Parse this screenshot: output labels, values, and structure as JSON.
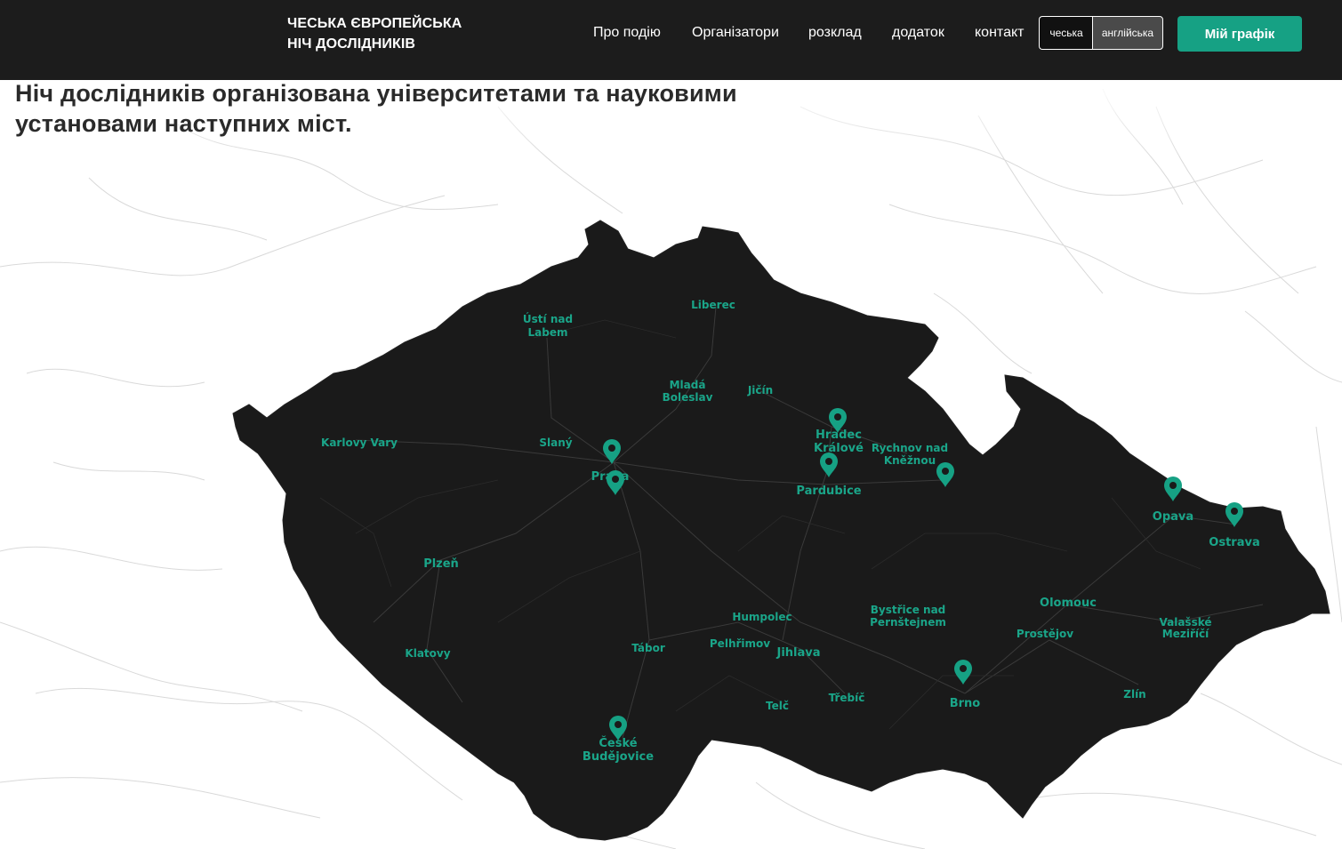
{
  "header": {
    "brand_line1": "ЧЕСЬКА ЄВРОПЕЙСЬКА",
    "brand_line2": "НІЧ ДОСЛІДНИКІВ",
    "nav": [
      "Про подію",
      "Організатори",
      "розклад",
      "додаток",
      "контакт"
    ],
    "lang_cs": "чеська",
    "lang_en": "англійська",
    "cta": "Мій графік"
  },
  "main": {
    "heading": "Ніч дослідників організована університетами та науковими установами наступних міст."
  },
  "colors": {
    "accent": "#16a184",
    "header_bg": "#1c1c1c",
    "map_fill": "#1a1a1a",
    "label_color": "#1aa589"
  },
  "map": {
    "cities": [
      "Ústí nad",
      "Labem",
      "Liberec",
      "Mladá",
      "Boleslav",
      "Jičín",
      "Karlovy Vary",
      "Slaný",
      "Praha",
      "Hradec",
      "Králové",
      "Rychnov nad",
      "Kněžnou",
      "Pardubice",
      "Opava",
      "Ostrava",
      "Plzeň",
      "Olomouc",
      "Humpolec",
      "Bystřice nad",
      "Pernštejnem",
      "Prostějov",
      "Valašské",
      "Meziříčí",
      "Klatovy",
      "Tábor",
      "Pelhřimov",
      "Jihlava",
      "Třebíč",
      "Brno",
      "Telč",
      "Zlín",
      "České",
      "Budějovice"
    ],
    "marker_icon": "map-pin-icon"
  }
}
